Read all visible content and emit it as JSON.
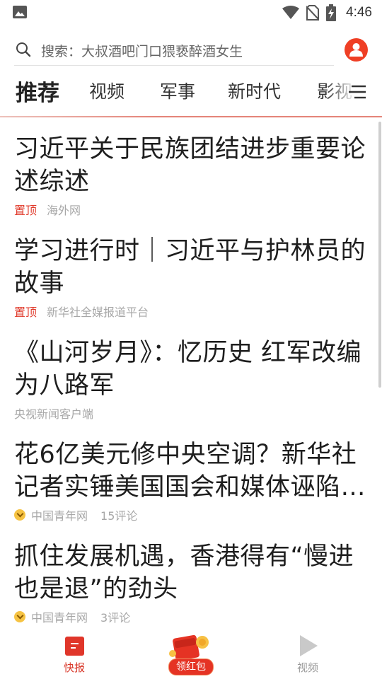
{
  "status_bar": {
    "time": "4:46"
  },
  "search": {
    "placeholder_text": "搜索：大叔酒吧门口猥亵醉酒女生"
  },
  "tabs": [
    {
      "label": "推荐",
      "active": true
    },
    {
      "label": "视频",
      "active": false
    },
    {
      "label": "军事",
      "active": false
    },
    {
      "label": "新时代",
      "active": false
    },
    {
      "label": "影视",
      "active": false
    }
  ],
  "articles": [
    {
      "title": "习近平关于民族团结进步重要论述综述",
      "pinned_label": "置顶",
      "source": "海外网",
      "comments": ""
    },
    {
      "title": "学习进行时｜习近平与护林员的故事",
      "pinned_label": "置顶",
      "source": "新华社全媒报道平台",
      "comments": ""
    },
    {
      "title": "《山河岁月》：忆历史 红军改编为八路军",
      "pinned_label": "",
      "source": "央视新闻客户端",
      "comments": ""
    },
    {
      "title_line1": "花6亿美元修中央空调？新华社",
      "title_line2": "记者实锤美国国会和媒体诬陷…",
      "pinned_label": "",
      "source": "中国青年网",
      "comments": "15评论"
    },
    {
      "title": "抓住发展机遇，香港得有“慢进也是退”的劲头",
      "pinned_label": "",
      "source": "中国青年网",
      "comments": "3评论"
    }
  ],
  "bottom_nav": {
    "kuaibao": "快报",
    "redpacket": "领红包",
    "video": "视频"
  },
  "colors": {
    "accent": "#e0362a",
    "badge": "#f6c343"
  }
}
